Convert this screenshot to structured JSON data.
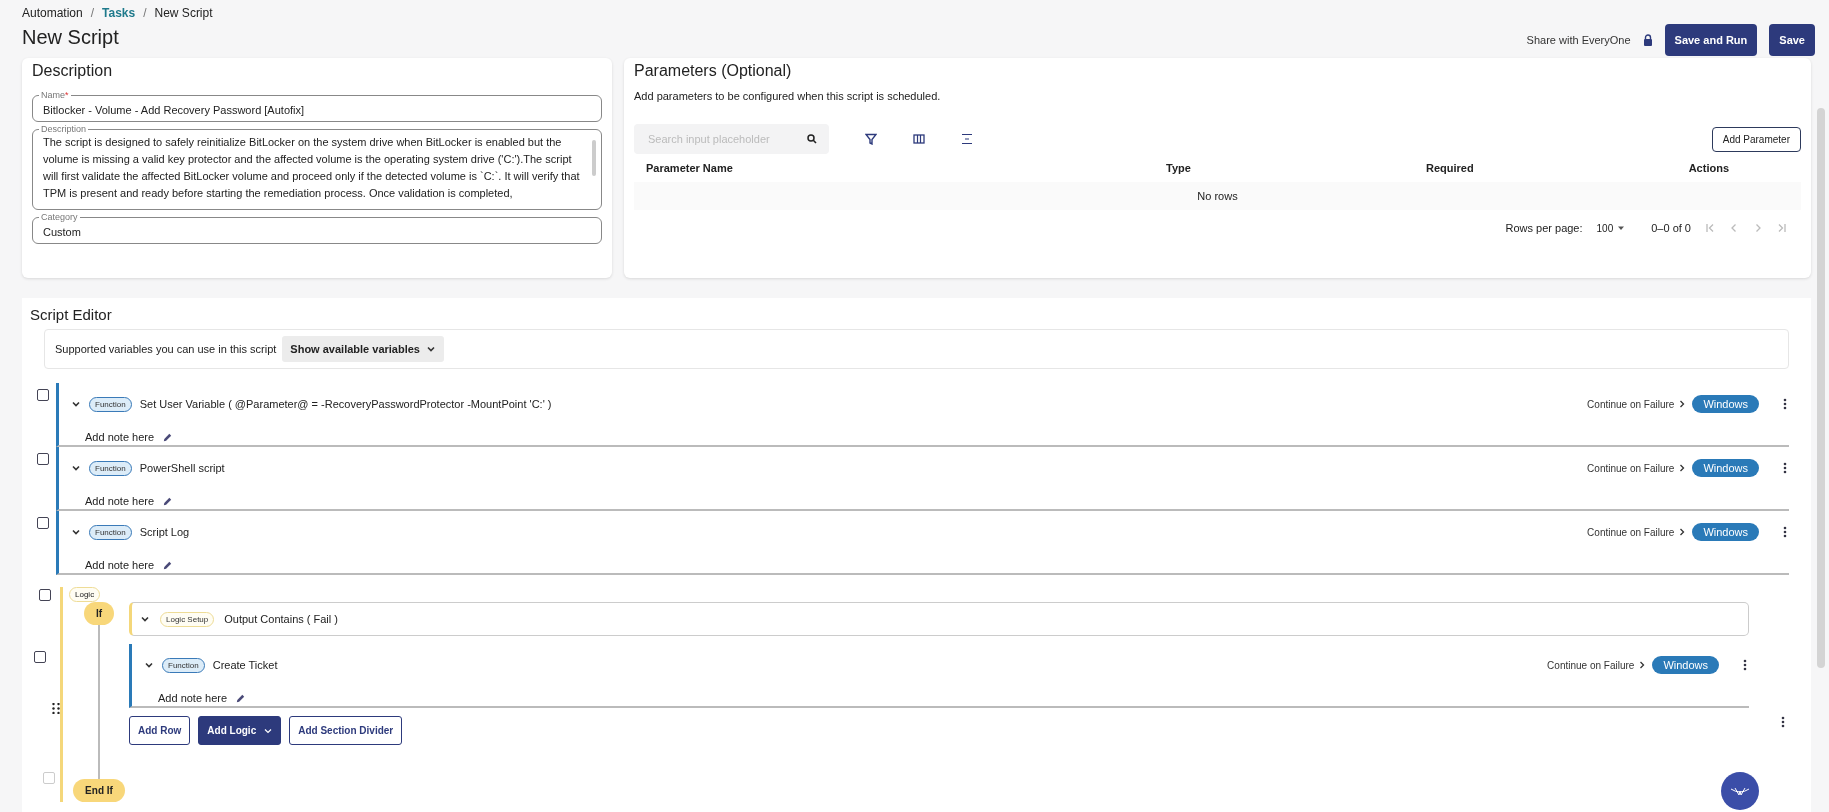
{
  "breadcrumb": [
    {
      "kind": "crumb",
      "label": "Automation",
      "link": false
    },
    {
      "kind": "separator",
      "label": "/"
    },
    {
      "kind": "crumb",
      "label": "Tasks",
      "link": true
    },
    {
      "kind": "separator",
      "label": "/"
    },
    {
      "kind": "crumb",
      "label": "New Script",
      "link": false
    }
  ],
  "title": "New Script",
  "header": {
    "share_label": "Share with EveryOne",
    "buttons": [
      "Save and Run",
      "Save"
    ]
  },
  "description": {
    "title": "Description",
    "fields": [
      {
        "kind": "input",
        "label": "Name",
        "required_mark": "*",
        "value": "Bitlocker - Volume - Add Recovery Password [Autofix]"
      },
      {
        "kind": "textarea",
        "label": "Description",
        "value": "The script is designed to safely reinitialize BitLocker on the system drive when BitLocker is enabled but the volume is missing a valid key protector and the affected volume is the operating system drive ('C:').The script will first validate the affected BitLocker volume and proceed only if the detected volume is `C:`. It will verify that TPM is present and ready before starting the remediation process. Once validation is completed,"
      },
      {
        "kind": "input",
        "label": "Category",
        "value": "Custom"
      }
    ]
  },
  "parameters": {
    "title": "Parameters (Optional)",
    "subtitle": "Add parameters to be configured when this script is scheduled.",
    "search": {
      "placeholder": "Search input placeholder"
    },
    "add_button": "Add Parameter",
    "columns": [
      "Parameter Name",
      "Type",
      "Required",
      "Actions"
    ],
    "empty_text": "No rows",
    "rows_per_page_label": "Rows per page:",
    "rows_per_page": "100",
    "range": "0–0 of 0"
  },
  "script_editor": {
    "title": "Script Editor",
    "variables_hint": "Supported variables you can use in this script",
    "variables_button": "Show available variables",
    "steps": [
      {
        "tag": "Function",
        "title": "Set User Variable ( @Parameter@ = -RecoveryPasswordProtector -MountPoint 'C:' )",
        "note": "Add note here",
        "failure": "Continue on Failure",
        "os": "Windows",
        "checked": false
      },
      {
        "tag": "Function",
        "title": "PowerShell script",
        "note": "Add note here",
        "failure": "Continue on Failure",
        "os": "Windows",
        "checked": false
      },
      {
        "tag": "Function",
        "title": "Script Log",
        "note": "Add note here",
        "failure": "Continue on Failure",
        "os": "Windows",
        "checked": false
      }
    ],
    "logic": {
      "tag": "Logic",
      "checked": false,
      "end_row": {
        "checked": false,
        "disabled": true
      },
      "if_label": "If",
      "end_label": "End If",
      "setup": {
        "tag": "Logic Setup",
        "title": "Output Contains ( Fail )"
      },
      "steps": [
        {
          "tag": "Function",
          "title": "Create Ticket",
          "note": "Add note here",
          "failure": "Continue on Failure",
          "os": "Windows",
          "checked": false
        }
      ],
      "buttons": [
        {
          "label": "Add Row",
          "kind": "outline"
        },
        {
          "label": "Add Logic",
          "kind": "primary"
        },
        {
          "label": "Add Section Divider",
          "kind": "outline"
        }
      ]
    }
  }
}
